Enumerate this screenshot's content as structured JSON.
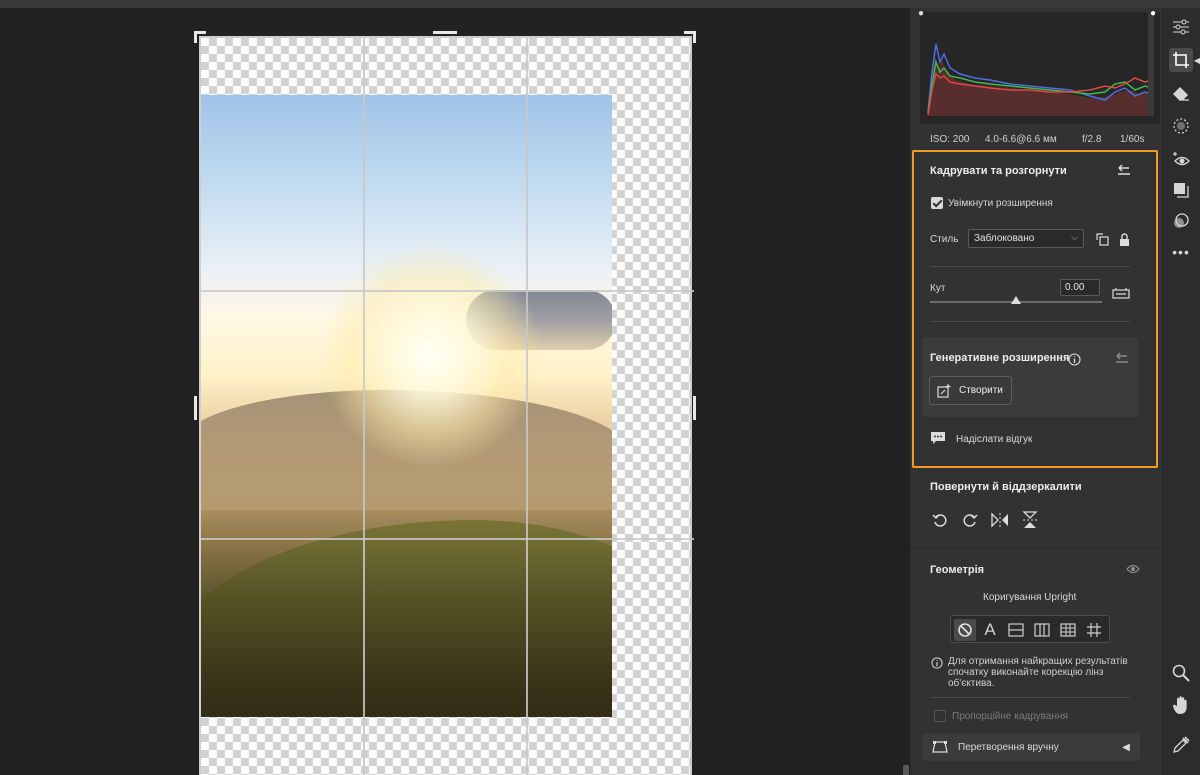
{
  "camera_info": {
    "iso": "ISO: 200",
    "lens": "4.0-6.6@6.6 мм",
    "aperture": "f/2.8",
    "shutter": "1/60s"
  },
  "crop_panel": {
    "title": "Кадрувати та розгорнути",
    "enable_expand_label": "Увімкнути розширення",
    "enable_expand_checked": true,
    "style_label": "Стиль",
    "style_value": "Заблоковано",
    "angle_label": "Кут",
    "angle_value": "0.00",
    "angle_slider_level": 0.5
  },
  "generative_expand": {
    "title": "Генеративне розширення",
    "create_button": "Створити",
    "feedback_link": "Надіслати відгук"
  },
  "rotate_panel": {
    "title": "Повернути й віддзеркалити"
  },
  "geometry_panel": {
    "title": "Геометрія",
    "upright_label": "Коригування Upright",
    "info_text_line1": "Для отримання найкращих результатів",
    "info_text_line2": "спочатку виконайте корекцію лінз",
    "info_text_line3": "об'єктива.",
    "proportional_crop_label": "Пропорційне кадрування",
    "manual_transform_label": "Перетворення вручну"
  },
  "colors": {
    "highlight": "#f39b23",
    "panel_bg": "#323232",
    "canvas_bg": "#222222"
  },
  "icons": {
    "tools": [
      "adjust-sliders-icon",
      "crop-icon",
      "eraser-icon",
      "mask-icon",
      "redeye-icon",
      "presets-icon",
      "snapshots-icon",
      "more-icon",
      "zoom-icon",
      "hand-icon",
      "eyedropper-icon"
    ]
  }
}
